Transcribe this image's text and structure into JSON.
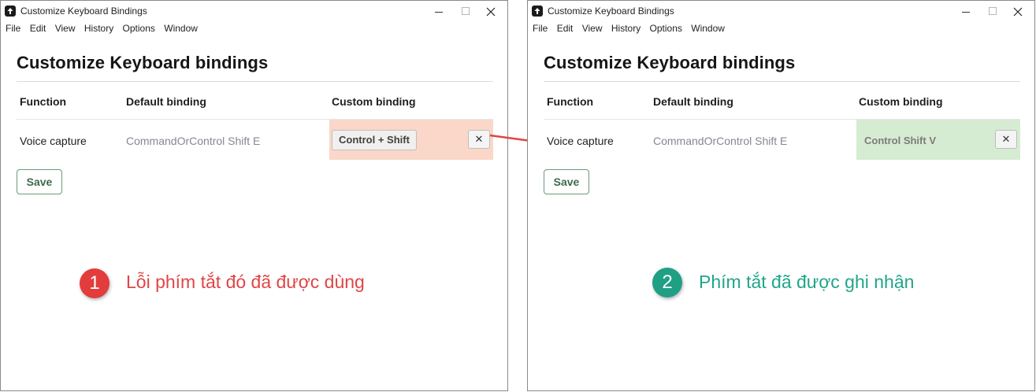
{
  "left_window": {
    "title": "Customize Keyboard Bindings",
    "menu": [
      "File",
      "Edit",
      "View",
      "History",
      "Options",
      "Window"
    ],
    "heading": "Customize Keyboard bindings",
    "columns": {
      "function": "Function",
      "default": "Default binding",
      "custom": "Custom binding"
    },
    "row": {
      "function": "Voice capture",
      "default": "CommandOrControl Shift E",
      "custom": "Control + Shift",
      "clear": "✕",
      "state": "error",
      "highlight_color": "#fad7c9"
    },
    "save_label": "Save"
  },
  "right_window": {
    "title": "Customize Keyboard Bindings",
    "menu": [
      "File",
      "Edit",
      "View",
      "History",
      "Options",
      "Window"
    ],
    "heading": "Customize Keyboard bindings",
    "columns": {
      "function": "Function",
      "default": "Default binding",
      "custom": "Custom binding"
    },
    "row": {
      "function": "Voice capture",
      "default": "CommandOrControl Shift E",
      "custom": "Control Shift V",
      "clear": "✕",
      "state": "ok",
      "highlight_color": "#d6ecd2"
    },
    "save_label": "Save"
  },
  "callouts": [
    {
      "number": "1",
      "text": "Lỗi phím tắt đó đã được dùng",
      "color": "#e33c3c"
    },
    {
      "number": "2",
      "text": "Phím tắt đã được ghi nhận",
      "color": "#1fa085"
    }
  ],
  "arrow_color": "#e04545"
}
